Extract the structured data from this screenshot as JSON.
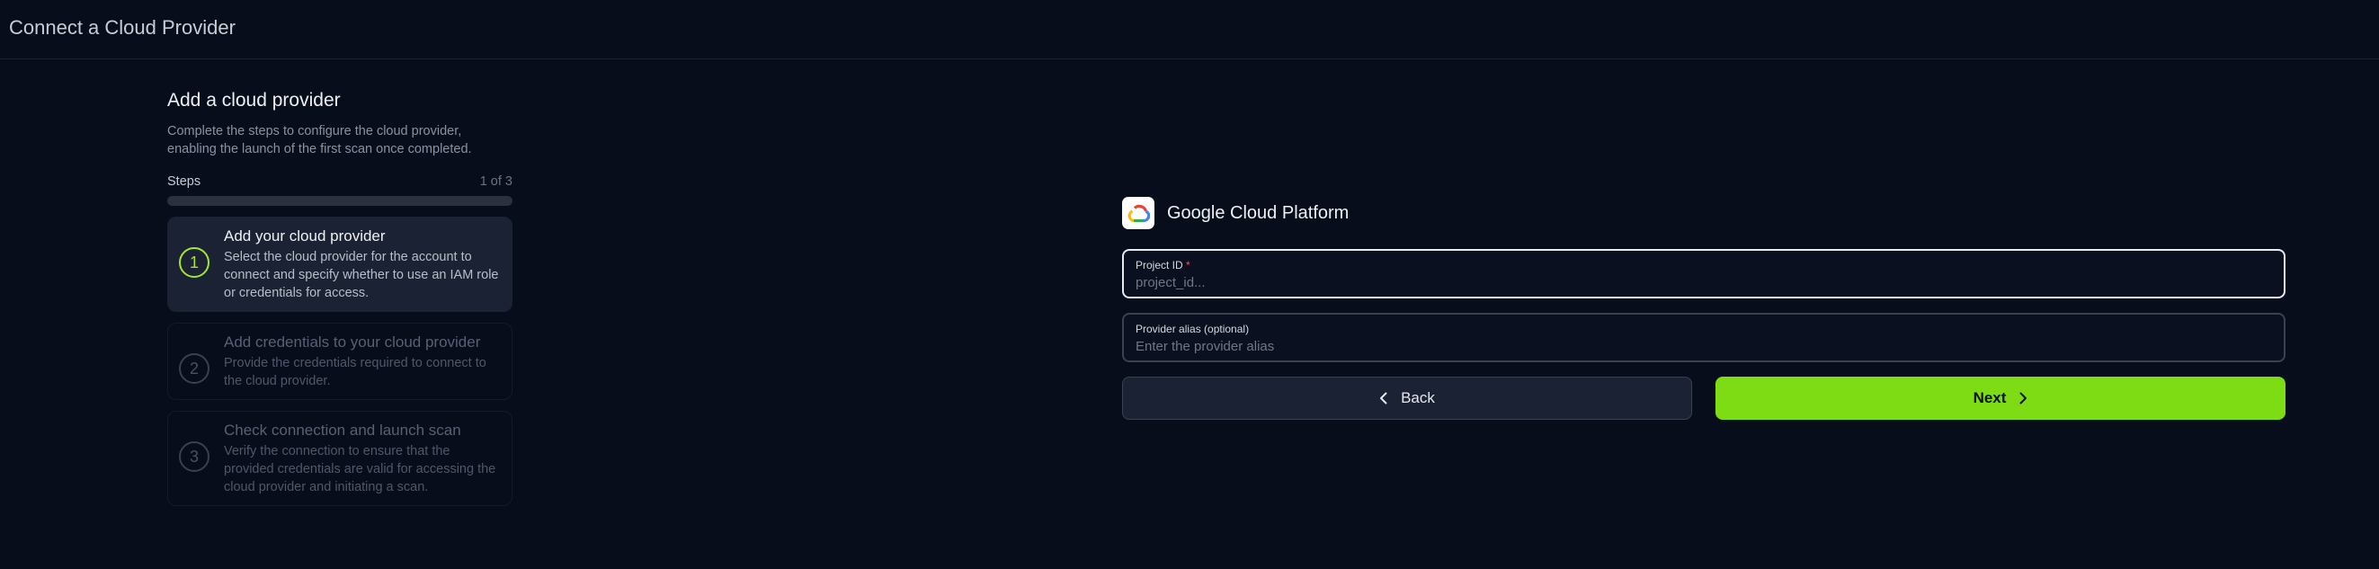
{
  "page": {
    "title": "Connect a Cloud Provider"
  },
  "intro": {
    "title": "Add a cloud provider",
    "description": "Complete the steps to configure the cloud provider, enabling the launch of the first scan once completed."
  },
  "steps": {
    "label": "Steps",
    "counter": "1 of 3",
    "progress": 0,
    "items": [
      {
        "number": "1",
        "title": "Add your cloud provider",
        "description": "Select the cloud provider for the account to connect and specify whether to use an IAM role or credentials for access.",
        "state": "active"
      },
      {
        "number": "2",
        "title": "Add credentials to your cloud provider",
        "description": "Provide the credentials required to connect to the cloud provider.",
        "state": "pending"
      },
      {
        "number": "3",
        "title": "Check connection and launch scan",
        "description": "Verify the connection to ensure that the provided credentials are valid for accessing the cloud provider and initiating a scan.",
        "state": "pending"
      }
    ]
  },
  "provider": {
    "name": "Google Cloud Platform",
    "icon": "google-cloud-logo"
  },
  "form": {
    "project_id": {
      "label": "Project ID",
      "required_mark": "*",
      "placeholder": "project_id...",
      "value": ""
    },
    "alias": {
      "label": "Provider alias (optional)",
      "placeholder": "Enter the provider alias",
      "value": ""
    }
  },
  "actions": {
    "back_label": "Back",
    "back_icon": "chevron-left-icon",
    "next_label": "Next",
    "next_icon": "chevron-right-icon"
  },
  "colors": {
    "accent": "#7ddc14",
    "background": "#080d1c",
    "panel": "#1b2233"
  }
}
